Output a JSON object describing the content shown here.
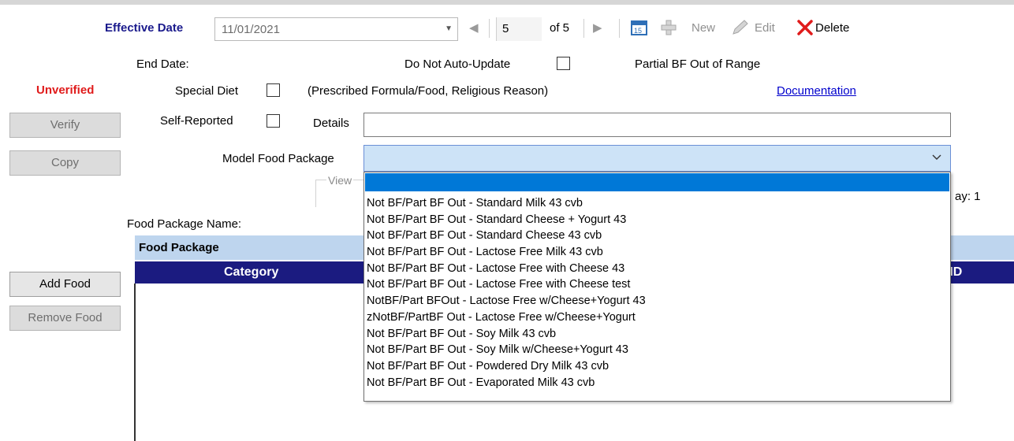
{
  "toolbar": {
    "effective_date_label": "Effective Date",
    "effective_date_value": "11/01/2021",
    "record_index": "5",
    "record_total": "of 5",
    "new_label": "New",
    "edit_label": "Edit",
    "delete_label": "Delete"
  },
  "form": {
    "end_date_label": "End Date:",
    "do_not_auto_update_label": "Do Not Auto-Update",
    "partial_bf_label": "Partial BF Out of Range",
    "status": "Unverified",
    "special_diet_label": "Special Diet",
    "special_diet_note": "(Prescribed Formula/Food, Religious Reason)",
    "documentation_link": "Documentation",
    "self_reported_label": "Self-Reported",
    "details_label": "Details",
    "details_value": "",
    "model_food_package_label": "Model Food Package",
    "view_label": "View",
    "day_label": "ay:  1",
    "food_package_name_label": "Food Package Name:"
  },
  "buttons": {
    "verify": "Verify",
    "copy": "Copy",
    "add_food": "Add Food",
    "remove_food": "Remove Food"
  },
  "grid": {
    "section_title": "Food Package",
    "columns": [
      "Category",
      "c ID"
    ]
  },
  "dropdown": {
    "selected": "",
    "options": [
      "Not BF/Part BF Out - Standard Milk 43 cvb",
      "Not BF/Part BF Out - Standard Cheese + Yogurt 43",
      "Not BF/Part BF Out - Standard Cheese 43 cvb",
      "Not BF/Part BF Out - Lactose Free Milk 43 cvb",
      "Not BF/Part BF Out - Lactose Free with Cheese 43",
      "Not BF/Part BF Out - Lactose Free with Cheese test",
      "NotBF/Part BFOut - Lactose Free w/Cheese+Yogurt 43",
      "zNotBF/PartBF Out - Lactose Free w/Cheese+Yogurt",
      "Not BF/Part BF Out - Soy Milk 43 cvb",
      "Not BF/Part BF Out - Soy Milk w/Cheese+Yogurt 43",
      "Not BF/Part BF Out - Powdered Dry Milk 43 cvb",
      "Not BF/Part BF Out - Evaporated Milk 43 cvb"
    ]
  },
  "colors": {
    "accent_blue": "#1b1b80",
    "status_red": "#e01b1b",
    "selection": "#0078d7",
    "header_band": "#bed5ee"
  }
}
